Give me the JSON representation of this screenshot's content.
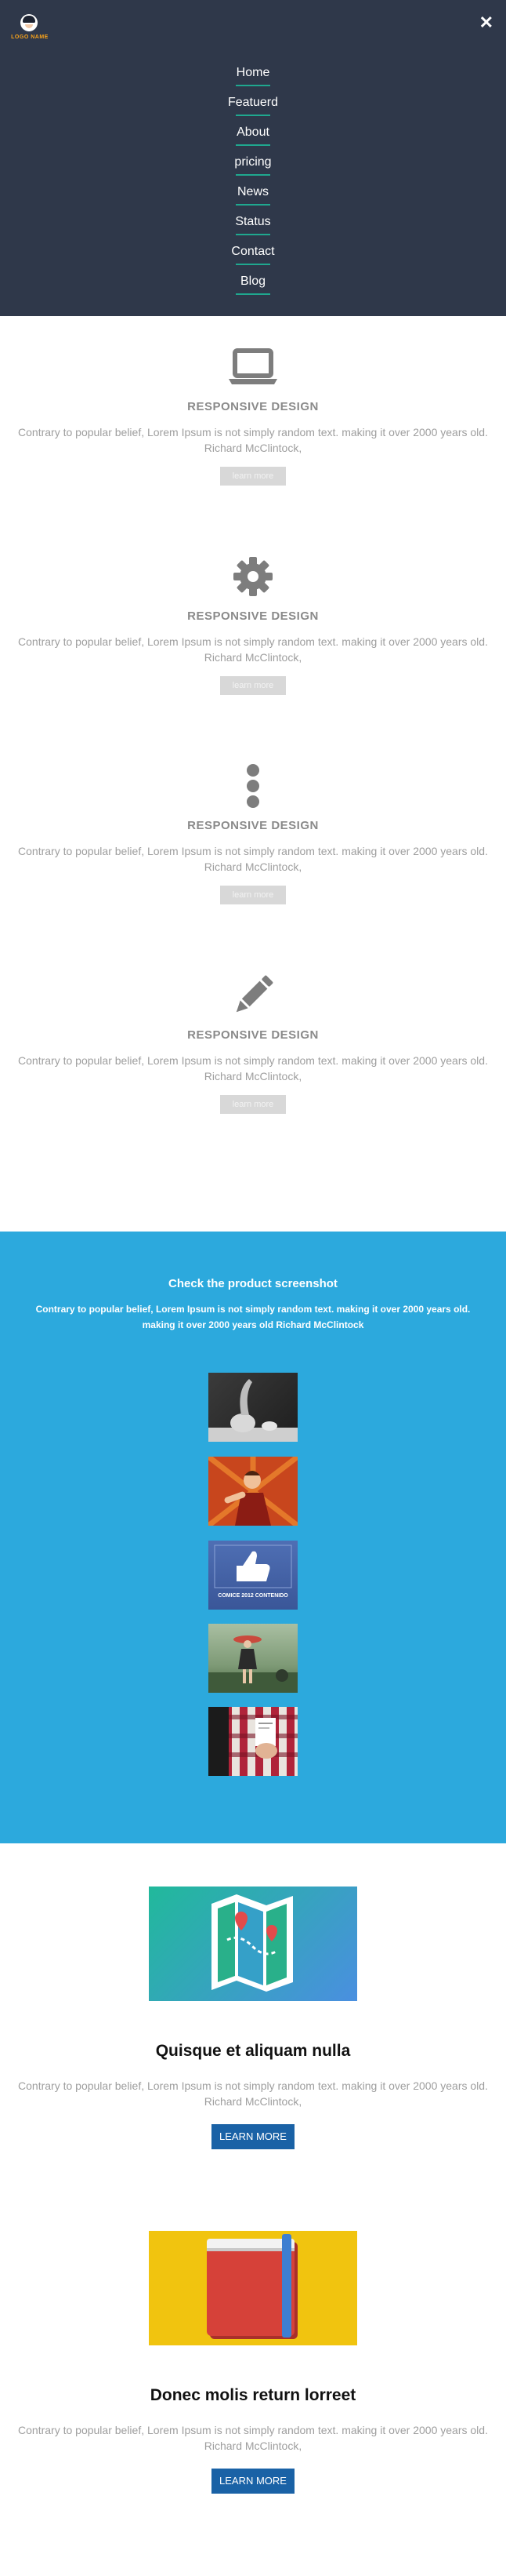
{
  "logo": {
    "name": "LOGO NAME",
    "icon": "mascot-icon"
  },
  "nav": {
    "close_icon": "close-icon",
    "items": [
      {
        "label": "Home"
      },
      {
        "label": "Featuerd"
      },
      {
        "label": "About"
      },
      {
        "label": "pricing"
      },
      {
        "label": "News"
      },
      {
        "label": "Status"
      },
      {
        "label": "Contact"
      },
      {
        "label": "Blog"
      }
    ]
  },
  "features": [
    {
      "icon": "laptop-icon",
      "title": "RESPONSIVE DESIGN",
      "text": "Contrary to popular belief, Lorem Ipsum is not simply random text. making it over 2000 years old. Richard McClintock,",
      "button": "learn more"
    },
    {
      "icon": "gear-icon",
      "title": "RESPONSIVE DESIGN",
      "text": "Contrary to popular belief, Lorem Ipsum is not simply random text. making it over 2000 years old. Richard McClintock,",
      "button": "learn more"
    },
    {
      "icon": "more-vertical-icon",
      "title": "RESPONSIVE DESIGN",
      "text": "Contrary to popular belief, Lorem Ipsum is not simply random text. making it over 2000 years old. Richard McClintock,",
      "button": "learn more"
    },
    {
      "icon": "pencil-icon",
      "title": "RESPONSIVE DESIGN",
      "text": "Contrary to popular belief, Lorem Ipsum is not simply random text. making it over 2000 years old. Richard McClintock,",
      "button": "learn more"
    }
  ],
  "screenshots": {
    "title": "Check the product screenshot",
    "text": "Contrary to popular belief, Lorem Ipsum is not simply random text. making it over 2000 years old. making it over 2000 years old Richard McClintock",
    "banner_text": "COMICE 2012 CONTENIDO"
  },
  "products": [
    {
      "image_icon": "map-icon",
      "title": "Quisque et aliquam nulla",
      "text": "Contrary to popular belief, Lorem Ipsum is not simply random text. making it over 2000 years old. Richard McClintock,",
      "button": "LEARN MORE"
    },
    {
      "image_icon": "book-icon",
      "title": "Donec molis return lorreet",
      "text": "Contrary to popular belief, Lorem Ipsum is not simply random text. making it over 2000 years old. Richard McClintock,",
      "button": "LEARN MORE"
    }
  ],
  "colors": {
    "nav_bg": "#2f384a",
    "menu_underline": "#1fa88f",
    "logo_text": "#f7a21b",
    "screenshot_bg": "#2ca9dd",
    "button_blue": "#1a62a6"
  }
}
